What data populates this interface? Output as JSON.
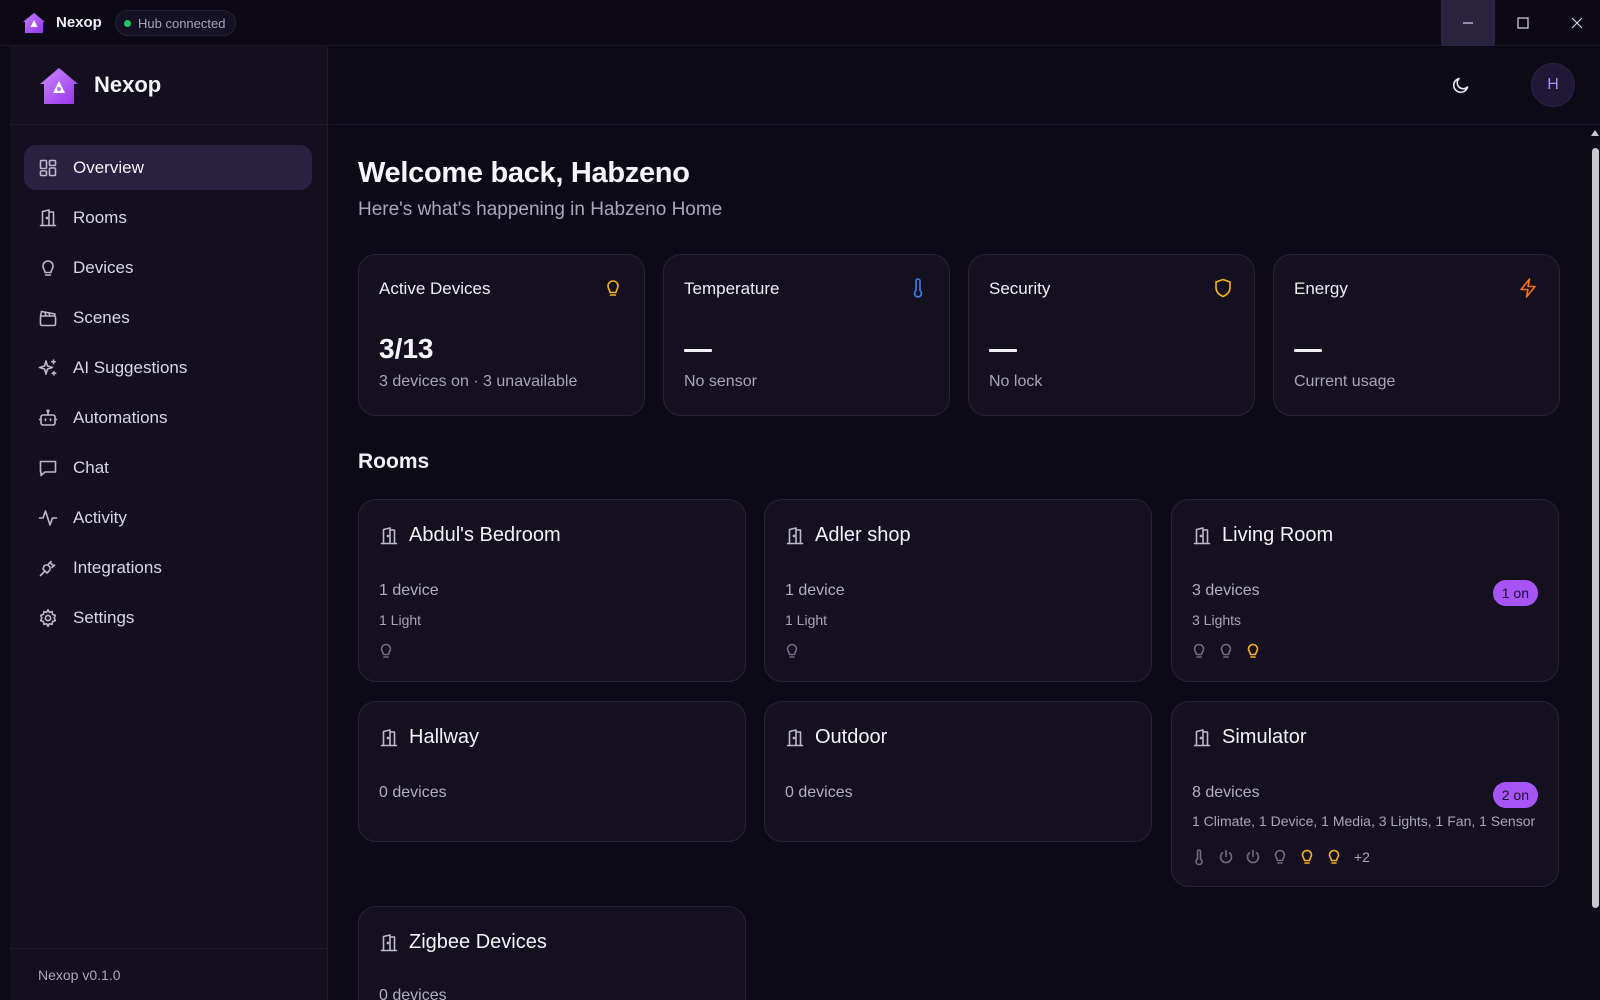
{
  "window": {
    "title": "Nexop",
    "hub_status": "Hub connected"
  },
  "sidebar": {
    "brand": "Nexop",
    "items": [
      {
        "label": "Overview",
        "icon": "grid-icon",
        "active": true
      },
      {
        "label": "Rooms",
        "icon": "door-icon"
      },
      {
        "label": "Devices",
        "icon": "lightbulb-icon"
      },
      {
        "label": "Scenes",
        "icon": "clapperboard-icon"
      },
      {
        "label": "AI Suggestions",
        "icon": "sparkles-icon"
      },
      {
        "label": "Automations",
        "icon": "bot-icon"
      },
      {
        "label": "Chat",
        "icon": "message-icon"
      },
      {
        "label": "Activity",
        "icon": "pulse-icon"
      },
      {
        "label": "Integrations",
        "icon": "plug-icon"
      },
      {
        "label": "Settings",
        "icon": "gear-icon"
      }
    ],
    "version": "Nexop v0.1.0"
  },
  "header": {
    "avatar_initial": "H"
  },
  "main": {
    "welcome": "Welcome back, Habzeno",
    "subtitle": "Here's what's happening in Habzeno Home",
    "stats": [
      {
        "title": "Active Devices",
        "value": "3/13",
        "sub": "3 devices on · 3 unavailable",
        "icon": "lightbulb-icon",
        "color": "#f5b31b"
      },
      {
        "title": "Temperature",
        "value": "",
        "sub": "No sensor",
        "icon": "thermometer-icon",
        "color": "#3b82f6"
      },
      {
        "title": "Security",
        "value": "",
        "sub": "No lock",
        "icon": "shield-icon",
        "color": "#f5b31b"
      },
      {
        "title": "Energy",
        "value": "",
        "sub": "Current usage",
        "icon": "lightning-icon",
        "color": "#f97316"
      }
    ],
    "rooms_title": "Rooms",
    "rooms": [
      {
        "name": "Abdul's Bedroom",
        "count": "1 device",
        "types": "1 Light",
        "badge": "",
        "devices": [
          "bulb-off"
        ]
      },
      {
        "name": "Adler shop",
        "count": "1 device",
        "types": "1 Light",
        "badge": "",
        "devices": [
          "bulb-off"
        ]
      },
      {
        "name": "Living Room",
        "count": "3 devices",
        "types": "3 Lights",
        "badge": "1 on",
        "devices": [
          "bulb-off",
          "bulb-off",
          "bulb-on"
        ]
      },
      {
        "name": "Hallway",
        "count": "0 devices",
        "types": "",
        "badge": "",
        "devices": []
      },
      {
        "name": "Outdoor",
        "count": "0 devices",
        "types": "",
        "badge": "",
        "devices": []
      },
      {
        "name": "Simulator",
        "count": "8 devices",
        "types": "1 Climate, 1 Device, 1 Media, 3 Lights, 1 Fan, 1 Sensor",
        "badge": "2 on",
        "devices": [
          "thermometer",
          "power",
          "power",
          "bulb-off",
          "bulb-on",
          "bulb-on"
        ],
        "more": "+2"
      },
      {
        "name": "Zigbee Devices",
        "count": "0 devices",
        "types": "",
        "badge": "",
        "devices": []
      }
    ]
  }
}
